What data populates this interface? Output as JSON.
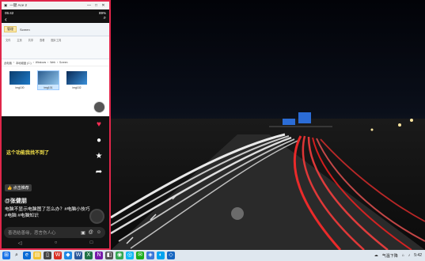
{
  "window": {
    "title": "一键 Ace 2",
    "controls": [
      "—",
      "□",
      "✕"
    ]
  },
  "phone_status": {
    "time": "05:42",
    "battery": "89%"
  },
  "explorer": {
    "tab_active": "管理",
    "location": "Screen",
    "ribbon_tabs": [
      "文件",
      "主页",
      "共享",
      "查看",
      "图片工具"
    ],
    "breadcrumb": [
      "此电脑",
      "本地磁盘 (C:)",
      "Windows",
      "Web",
      "Screen"
    ],
    "files": [
      {
        "name": "img100"
      },
      {
        "name": "img101"
      },
      {
        "name": "img102"
      }
    ]
  },
  "video": {
    "caption": "这个功能我找不到了",
    "recommend": "点击推荐",
    "author": "@张健朋",
    "description": "电脑不显示电脑图了怎么办？#电脑小技巧 #电脑 #电脑知识"
  },
  "comment": {
    "placeholder": "善语结善缘，恶言伤人心",
    "icons": [
      "image-icon",
      "at-icon",
      "emoji-icon"
    ]
  },
  "taskbar": {
    "weather": "气温下降",
    "time": "5:42"
  },
  "colors": {
    "window_border": "#e0264a",
    "caption_yellow": "#f5e34a",
    "taskbar_bg": "#dfe7ef"
  }
}
